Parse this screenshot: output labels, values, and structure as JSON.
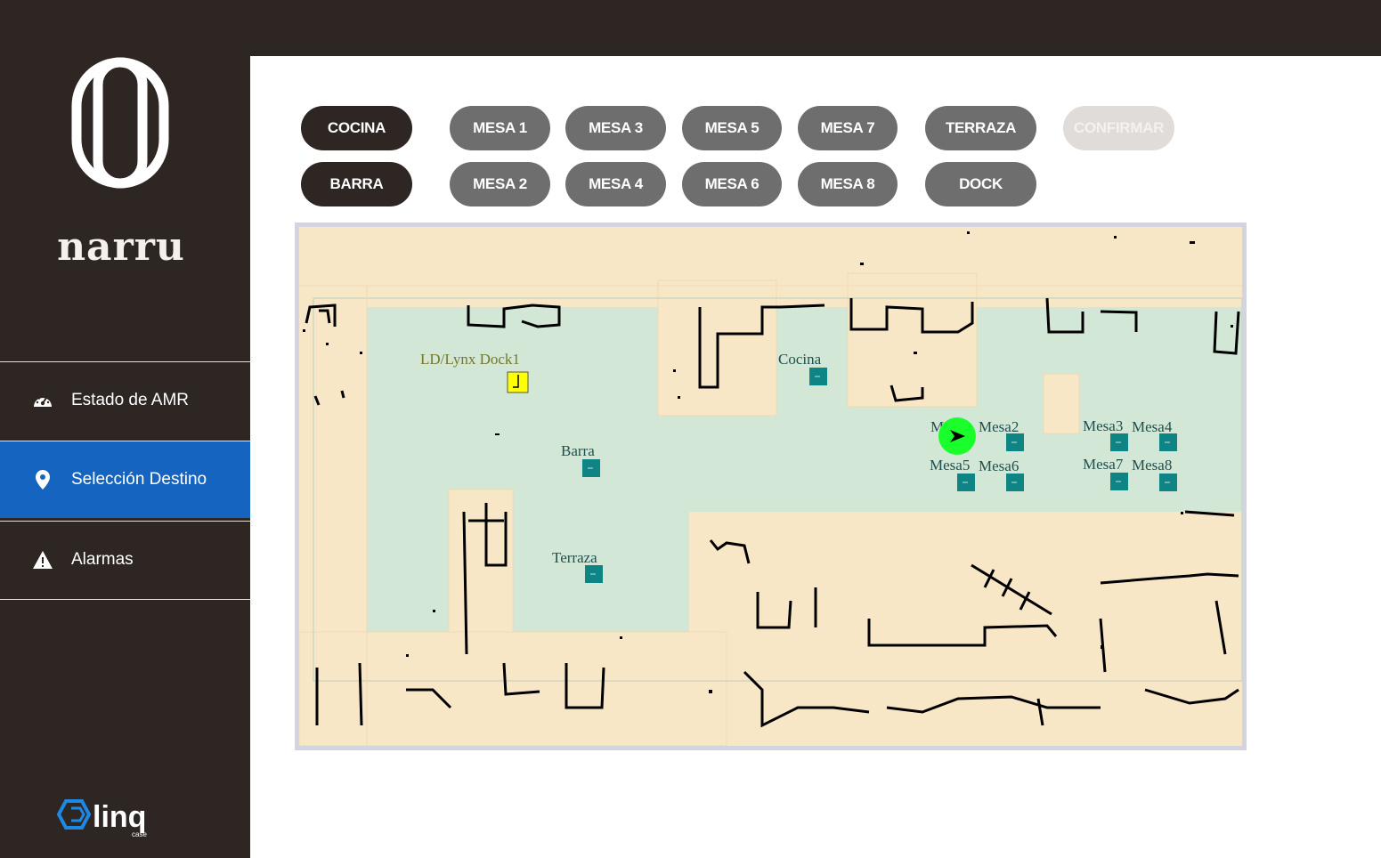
{
  "brand": {
    "name": "narru"
  },
  "nav": {
    "items": [
      {
        "label": "Estado de AMR",
        "icon": "speedometer-icon"
      },
      {
        "label": "Selección Destino",
        "icon": "location-pin-icon",
        "active": true
      },
      {
        "label": "Alarmas",
        "icon": "warning-icon"
      }
    ]
  },
  "footer_logo": {
    "name": "linq",
    "sub": "case"
  },
  "destinations": {
    "row1": [
      "COCINA",
      "MESA 1",
      "MESA 3",
      "MESA 5",
      "MESA 7",
      "TERRAZA"
    ],
    "row2": [
      "BARRA",
      "MESA 2",
      "MESA 4",
      "MESA 6",
      "MESA 8",
      "DOCK"
    ],
    "confirm_label": "CONFIRMAR",
    "confirm_enabled": false
  },
  "map": {
    "labels": {
      "dock": "LD/Lynx Dock1",
      "cocina": "Cocina",
      "barra": "Barra",
      "terraza": "Terraza",
      "mesa1": "Mesa1",
      "mesa2": "Mesa2",
      "mesa3": "Mesa3",
      "mesa4": "Mesa4",
      "mesa5": "Mesa5",
      "mesa6": "Mesa6",
      "mesa7": "Mesa7",
      "mesa8": "Mesa8"
    },
    "colors": {
      "zone": "#f8e7c7",
      "floor": "#d3e7d6",
      "goal": "#0f8484",
      "dock": "#ffff00",
      "robot": "#1aff2c"
    }
  }
}
